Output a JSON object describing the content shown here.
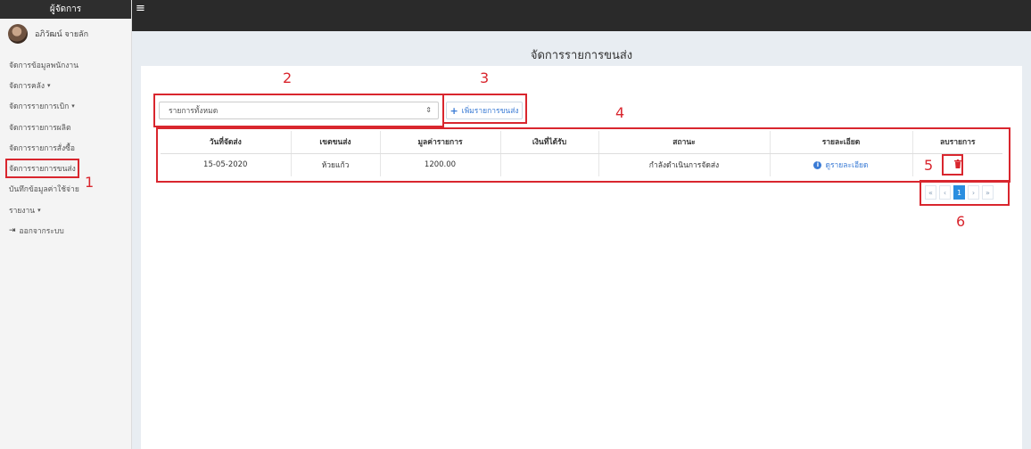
{
  "sidebar": {
    "header": "ผู้จัดการ",
    "user_name": "อภิวัฒน์ จายลัก",
    "items": [
      {
        "label": "จัดการข้อมูลพนักงาน",
        "caret": ""
      },
      {
        "label": "จัดการคลัง",
        "caret": "▾"
      },
      {
        "label": "จัดการรายการเบิก",
        "caret": "▾"
      },
      {
        "label": "จัดการรายการผลิต",
        "caret": ""
      },
      {
        "label": "จัดการรายการสั่งซื้อ",
        "caret": ""
      },
      {
        "label": "จัดการรายการขนส่ง",
        "caret": ""
      },
      {
        "label": "บันทึกข้อมูลค่าใช้จ่าย",
        "caret": ""
      },
      {
        "label": "รายงาน",
        "caret": "▾"
      },
      {
        "label": "ออกจากระบบ",
        "caret": ""
      }
    ]
  },
  "topbar": {
    "menu_icon": "≡"
  },
  "page": {
    "title": "จัดการรายการขนส่ง"
  },
  "filter": {
    "selected": "รายการทั้งหมด",
    "arrow": "⇕"
  },
  "add_button": {
    "plus": "+",
    "label": "เพิ่มรายการขนส่ง"
  },
  "table": {
    "headers": [
      "วันที่จัดส่ง",
      "เขตขนส่ง",
      "มูลค่ารายการ",
      "เงินที่ได้รับ",
      "สถานะ",
      "รายละเอียด",
      "ลบรายการ"
    ],
    "rows": [
      {
        "date": "15-05-2020",
        "zone": "ห้วยแก้ว",
        "value": "1200.00",
        "received": "",
        "status": "กำลังดำเนินการจัดส่ง",
        "detail": "ดูรายละเอียด",
        "delete_icon": "trash-icon"
      }
    ]
  },
  "pagination": {
    "first": "«",
    "prev": "‹",
    "current": "1",
    "next": "›",
    "last": "»"
  },
  "callouts": {
    "c1": "1",
    "c2": "2",
    "c3": "3",
    "c4": "4",
    "c5": "5",
    "c6": "6"
  },
  "colors": {
    "accent": "#3a7bd5",
    "callout_red": "#d9262e",
    "status_orange": "#f08c5a",
    "topbar": "#2a2a2a"
  }
}
